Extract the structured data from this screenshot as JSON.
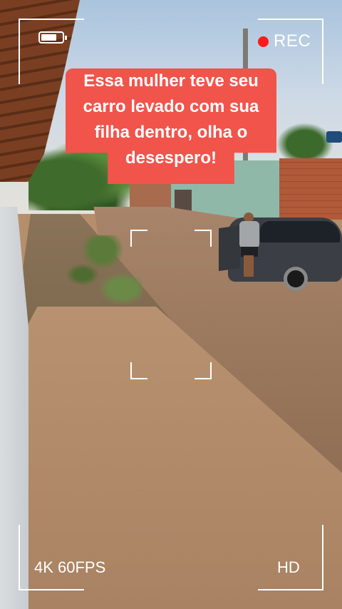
{
  "overlay": {
    "caption_lines": [
      "Essa mulher teve seu",
      "carro levado com sua",
      "filha dentro, olha o",
      "desespero!"
    ],
    "rec_label": "REC",
    "resolution_label": "4K 60FPS",
    "quality_label": "HD",
    "battery_level": 0.75
  },
  "colors": {
    "caption_background": "#f0544b",
    "rec_dot": "#ff1a1a",
    "overlay_text": "#ffffff"
  },
  "icons": [
    "battery-icon",
    "record-dot-icon"
  ]
}
